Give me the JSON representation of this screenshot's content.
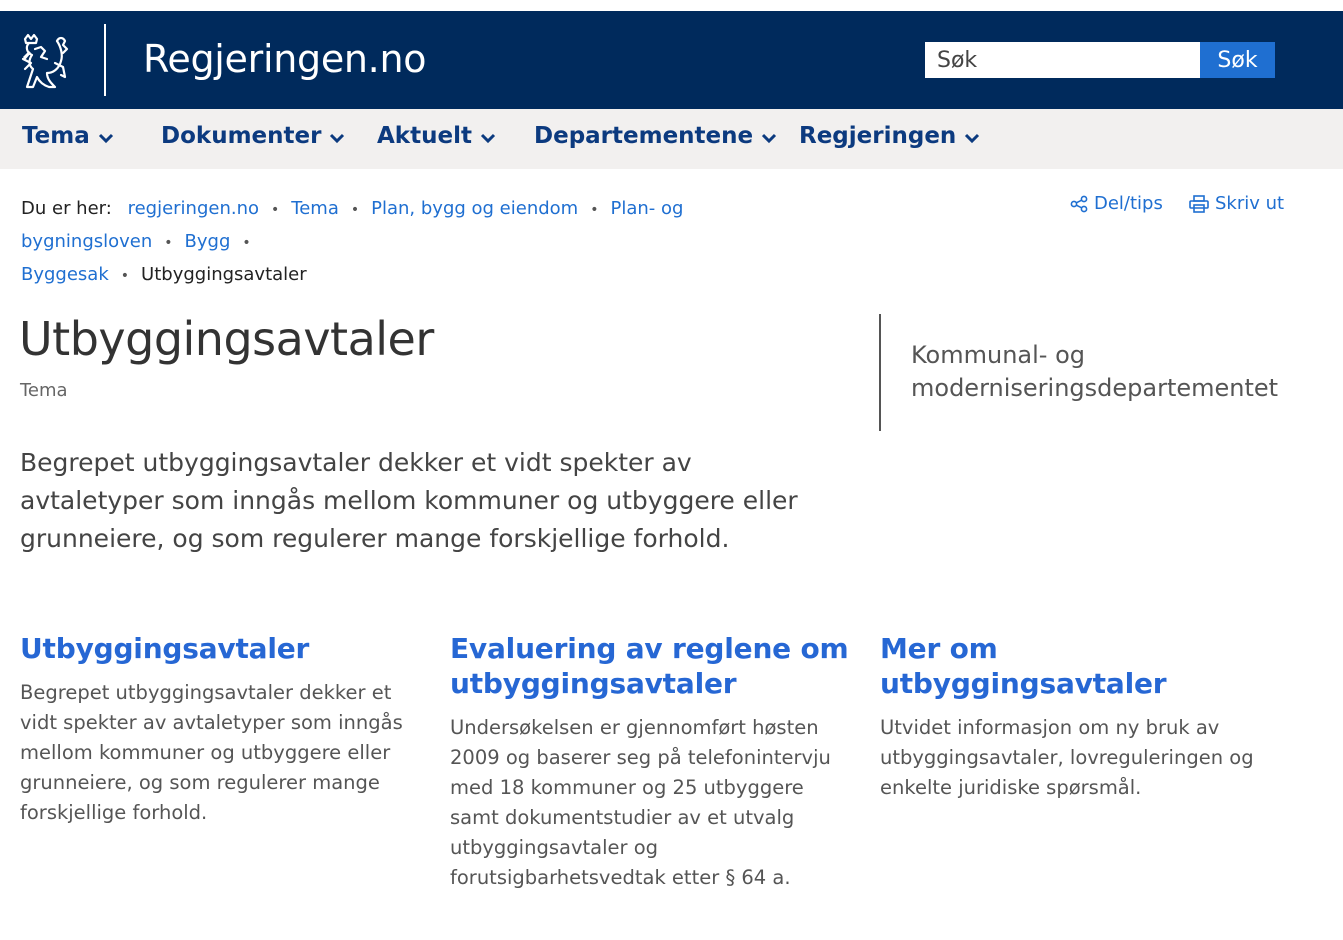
{
  "header": {
    "site_title": "Regjeringen.no",
    "search": {
      "placeholder": "Søk",
      "button_label": "Søk"
    },
    "colors": {
      "background": "#002a5c",
      "accent": "#1f6fd1"
    },
    "logo_icon": "norwegian-lion-coat-of-arms-icon"
  },
  "nav": {
    "items": [
      {
        "label": "Tema"
      },
      {
        "label": "Dokumenter"
      },
      {
        "label": "Aktuelt"
      },
      {
        "label": "Departementene"
      },
      {
        "label": "Regjeringen"
      }
    ],
    "chevron_icon": "chevron-down-icon"
  },
  "breadcrumb": {
    "label": "Du er her:",
    "links": [
      {
        "text": "regjeringen.no"
      },
      {
        "text": "Tema"
      },
      {
        "text": "Plan, bygg og eiendom"
      },
      {
        "text": "Plan- og bygningsloven"
      },
      {
        "text": "Bygg"
      },
      {
        "text": "Byggesak"
      }
    ],
    "current": "Utbyggingsavtaler",
    "separator": "•"
  },
  "tools": {
    "share_label": "Del/tips",
    "share_icon": "share-icon",
    "print_label": "Skriv ut",
    "print_icon": "printer-icon"
  },
  "page": {
    "title": "Utbyggingsavtaler",
    "type": "Tema",
    "department": "Kommunal- og moderniseringsdepartementet",
    "lead": "Begrepet utbyggingsavtaler dekker et vidt spekter av avtaletyper som inngås mellom kommuner og utbyggere eller grunneiere, og som regulerer mange forskjellige forhold."
  },
  "cards": [
    {
      "title": "Utbyggingsavtaler",
      "text": "Begrepet utbyggingsavtaler dekker et vidt spekter av avtaletyper som inngås mellom kommuner og utbyggere eller grunneiere, og som regulerer mange forskjellige forhold."
    },
    {
      "title": "Evaluering av reglene om utbyggingsavtaler",
      "text": "Undersøkelsen er gjennomført høsten 2009 og baserer seg på telefonintervju med 18 kommuner og 25 utbyggere samt dokumentstudier av et utvalg utbyggingsavtaler og forutsigbarhetsvedtak etter § 64 a."
    },
    {
      "title": "Mer om utbyggingsavtaler",
      "text": "Utvidet informasjon om ny bruk av utbyggingsavtaler, lovreguleringen og enkelte juridiske spørsmål."
    }
  ]
}
